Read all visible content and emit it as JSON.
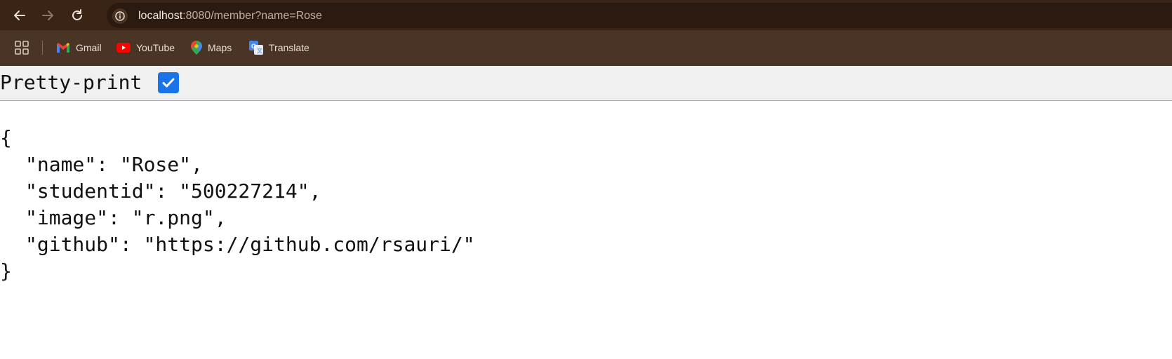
{
  "browser": {
    "address_bar": {
      "host": "localhost",
      "path": ":8080/member?name=Rose"
    },
    "bookmarks": [
      {
        "label": "Gmail",
        "icon": "gmail-icon"
      },
      {
        "label": "YouTube",
        "icon": "youtube-icon"
      },
      {
        "label": "Maps",
        "icon": "maps-icon"
      },
      {
        "label": "Translate",
        "icon": "translate-icon"
      }
    ],
    "colors": {
      "toolbar": "#3a2416",
      "bookmarks_bar": "#4a3425",
      "checkbox": "#1a73e8"
    }
  },
  "page": {
    "pretty_print_label": "Pretty-print",
    "pretty_print_checked": true,
    "json": {
      "open": "{",
      "close": "}",
      "lines": [
        "\"name\": \"Rose\",",
        "\"studentid\": \"500227214\",",
        "\"image\": \"r.png\",",
        "\"github\": \"https://github.com/rsauri/\""
      ]
    }
  }
}
